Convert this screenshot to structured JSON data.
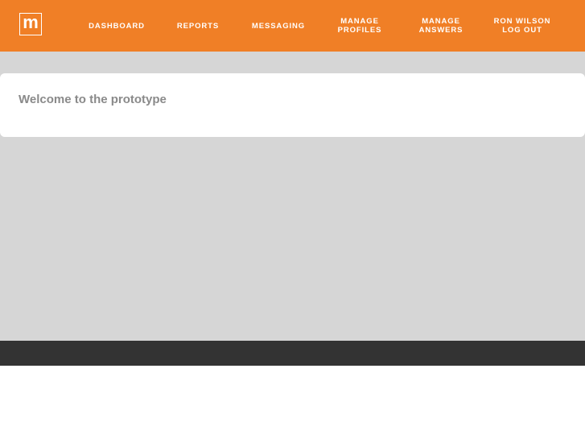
{
  "brand": {
    "logo_letter": "m",
    "accent_color": "#f07f26"
  },
  "nav": {
    "dashboard": "DASHBOARD",
    "reports": "REPORTS",
    "messaging": "MESSAGING",
    "manage_profiles": [
      "MANAGE",
      "PROFILES"
    ],
    "manage_answers": [
      "MANAGE",
      "ANSWERS"
    ],
    "user_name": "RON WILSON",
    "logout": "LOG OUT"
  },
  "main": {
    "welcome_text": "Welcome to the prototype"
  },
  "colors": {
    "content_background": "#d6d6d6",
    "footer_background": "#333333",
    "welcome_text_color": "#8a8a8a"
  }
}
